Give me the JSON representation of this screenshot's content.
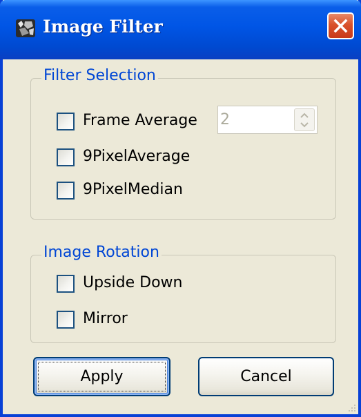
{
  "window": {
    "title": "Image Filter",
    "app_icon": "app-logo-icon",
    "close_icon": "close-icon"
  },
  "filter_selection": {
    "legend": "Filter Selection",
    "frame_average": {
      "label": "Frame Average",
      "checked": false
    },
    "frame_count": {
      "value": "2",
      "enabled": false
    },
    "nine_pixel_average": {
      "label": "9PixelAverage",
      "checked": false
    },
    "nine_pixel_median": {
      "label": "9PixelMedian",
      "checked": false
    }
  },
  "image_rotation": {
    "legend": "Image Rotation",
    "upside_down": {
      "label": "Upside Down",
      "checked": false
    },
    "mirror": {
      "label": "Mirror",
      "checked": false
    }
  },
  "buttons": {
    "apply": "Apply",
    "cancel": "Cancel"
  },
  "colors": {
    "title_bar": "#0055e5",
    "legend_text": "#0046d5",
    "window_bg": "#ece9d8",
    "close_button": "#d9512b"
  }
}
